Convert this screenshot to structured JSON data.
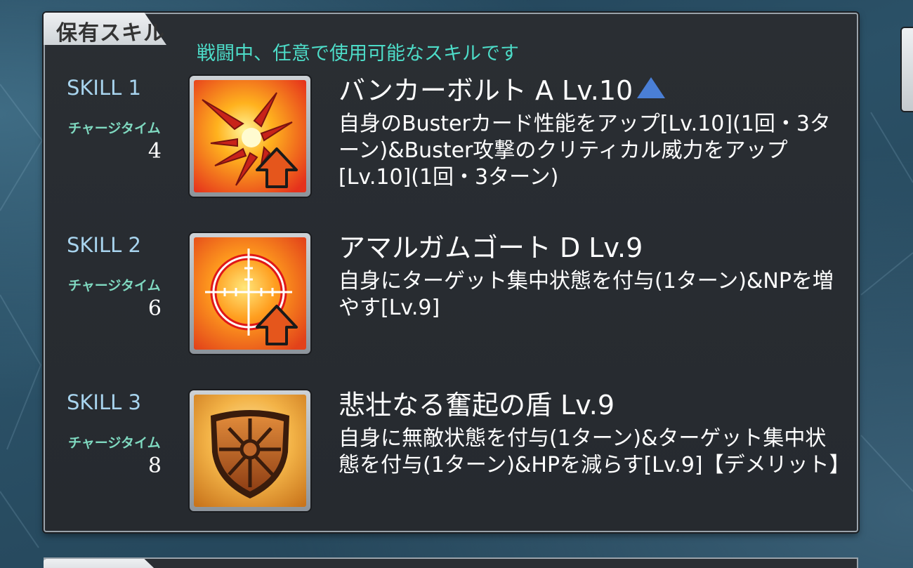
{
  "panel": {
    "tab_title": "保有スキル",
    "subtitle": "戦闘中、任意で使用可能なスキルです"
  },
  "skills": [
    {
      "slot": "SKILL 1",
      "charge_label": "チャージタイム",
      "charge_value": "4",
      "name": "バンカーボルト A Lv.10",
      "icon": "buster-burst-up-icon",
      "description": "自身のBusterカード性能をアップ[Lv.10](1回・3ターン)&Buster攻撃のクリティカル威力をアップ[Lv.10](1回・3ターン)"
    },
    {
      "slot": "SKILL 2",
      "charge_label": "チャージタイム",
      "charge_value": "6",
      "name": "アマルガムゴート D Lv.9",
      "icon": "target-focus-up-icon",
      "description": "自身にターゲット集中状態を付与(1ターン)&NPを増やす[Lv.9]"
    },
    {
      "slot": "SKILL 3",
      "charge_label": "チャージタイム",
      "charge_value": "8",
      "name": "悲壮なる奮起の盾 Lv.9",
      "icon": "shield-icon",
      "description": "自身に無敵状態を付与(1ターン)&ターゲット集中状態を付与(1ターン)&HPを減らす[Lv.9]【デメリット】"
    }
  ],
  "colors": {
    "subtitle": "#4ddcc8",
    "skill_label": "#a8d4ee",
    "charge_label": "#7fd9c0",
    "level_up_arrow": "#4a7fd6"
  }
}
